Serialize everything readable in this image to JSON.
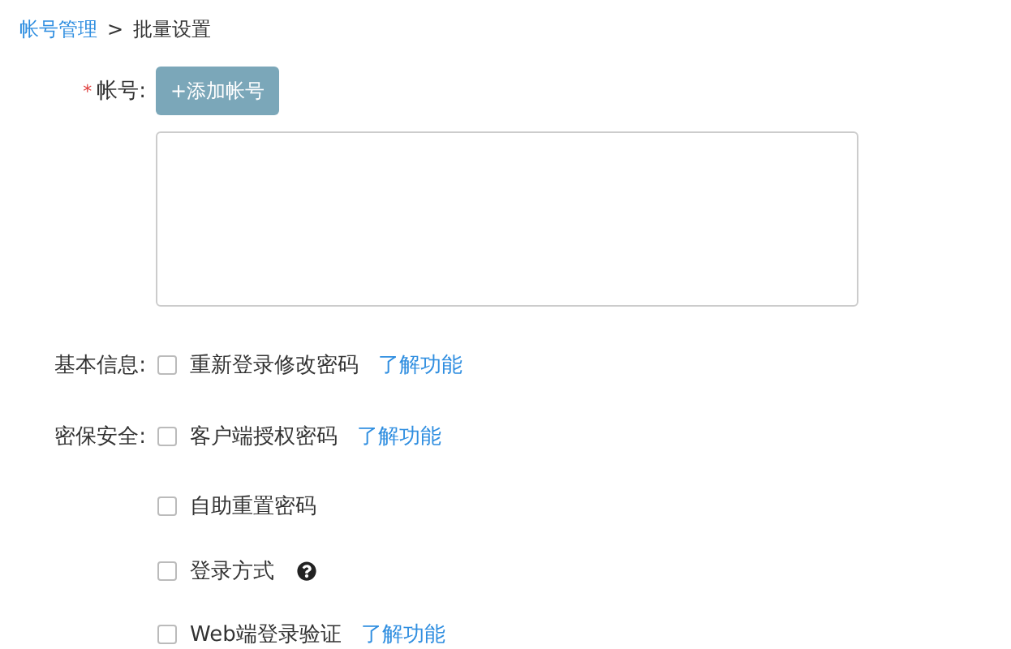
{
  "breadcrumb": {
    "parent": "帐号管理",
    "separator": ">",
    "current": "批量设置"
  },
  "account": {
    "required_mark": "*",
    "label": "帐号:",
    "add_button": "+添加帐号"
  },
  "sections": [
    {
      "label": "基本信息:",
      "options": [
        {
          "kind": "link",
          "text": "重新登录修改密码",
          "checked": false,
          "link": "了解功能"
        }
      ]
    },
    {
      "label": "密保安全:",
      "options": [
        {
          "kind": "link",
          "text": "客户端授权密码",
          "checked": false,
          "link": "了解功能"
        },
        {
          "kind": "plain",
          "text": "自助重置密码",
          "checked": false
        },
        {
          "kind": "help",
          "text": "登录方式",
          "checked": false
        },
        {
          "kind": "link",
          "text": "Web端登录验证",
          "checked": false,
          "link": "了解功能"
        }
      ]
    }
  ]
}
